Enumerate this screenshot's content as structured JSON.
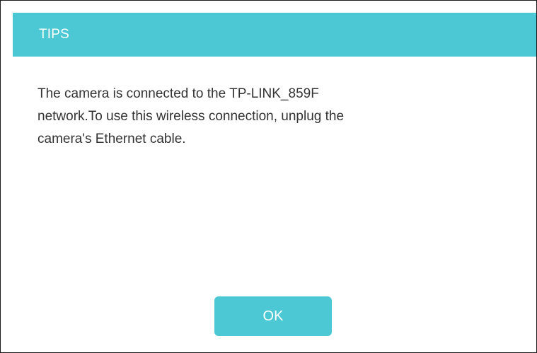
{
  "dialog": {
    "title": "TIPS",
    "message": "The camera is connected to the TP-LINK_859F\nnetwork.To use this wireless connection, unplug the\ncamera's Ethernet cable.",
    "ok_label": "OK"
  },
  "colors": {
    "accent": "#4cc8d4",
    "text": "#333333",
    "title_text": "#ffffff"
  }
}
